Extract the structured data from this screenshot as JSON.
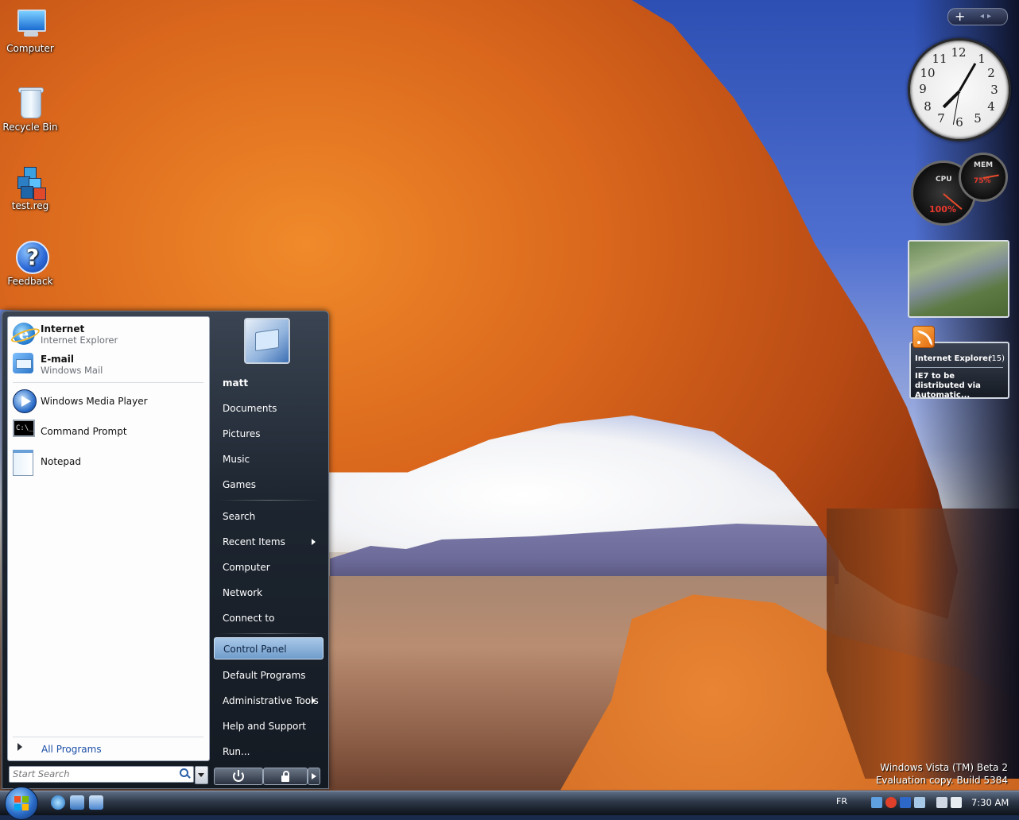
{
  "desktop_icons": [
    {
      "label": "Computer",
      "icon": "computer-icon"
    },
    {
      "label": "Recycle Bin",
      "icon": "recycle-bin-icon"
    },
    {
      "label": "test.reg",
      "icon": "registry-file-icon"
    },
    {
      "label": "Feedback",
      "icon": "help-feedback-icon"
    }
  ],
  "start_menu": {
    "pinned": [
      {
        "main": "Internet",
        "sub": "Internet Explorer",
        "icon": "internet-explorer-icon"
      },
      {
        "main": "E-mail",
        "sub": "Windows Mail",
        "icon": "windows-mail-icon"
      }
    ],
    "recent": [
      {
        "label": "Windows Media Player",
        "icon": "windows-media-player-icon"
      },
      {
        "label": "Command Prompt",
        "icon": "command-prompt-icon",
        "glyph": "C:\\_"
      },
      {
        "label": "Notepad",
        "icon": "notepad-icon"
      }
    ],
    "all_programs": "All Programs",
    "search_placeholder": "Start Search",
    "user_name": "matt",
    "right_items": [
      "Documents",
      "Pictures",
      "Music",
      "Games",
      "Search",
      "Recent Items",
      "Computer",
      "Network",
      "Connect to",
      "Control Panel",
      "Default Programs",
      "Administrative Tools",
      "Help and Support",
      "Run..."
    ],
    "highlighted_item": "Control Panel"
  },
  "gadgets": {
    "clock_numbers": [
      "12",
      "1",
      "2",
      "3",
      "4",
      "5",
      "6",
      "7",
      "8",
      "9",
      "10",
      "11"
    ],
    "cpu_label": "CPU",
    "cpu_value": "100%",
    "mem_label": "MEM",
    "mem_value": "75%",
    "feed_title": "Internet Explorer",
    "feed_count": "(15)",
    "feed_headline": "IE7 to be distributed via Automatic..."
  },
  "watermark": {
    "line1": "Windows Vista (TM) Beta 2",
    "line2": "Evaluation copy. Build 5384"
  },
  "taskbar": {
    "language": "FR",
    "time": "7:30 AM"
  },
  "colors": {
    "accent": "#2a6cc8",
    "highlight": "#8fb4dc",
    "taskbar": "#2c3646"
  }
}
